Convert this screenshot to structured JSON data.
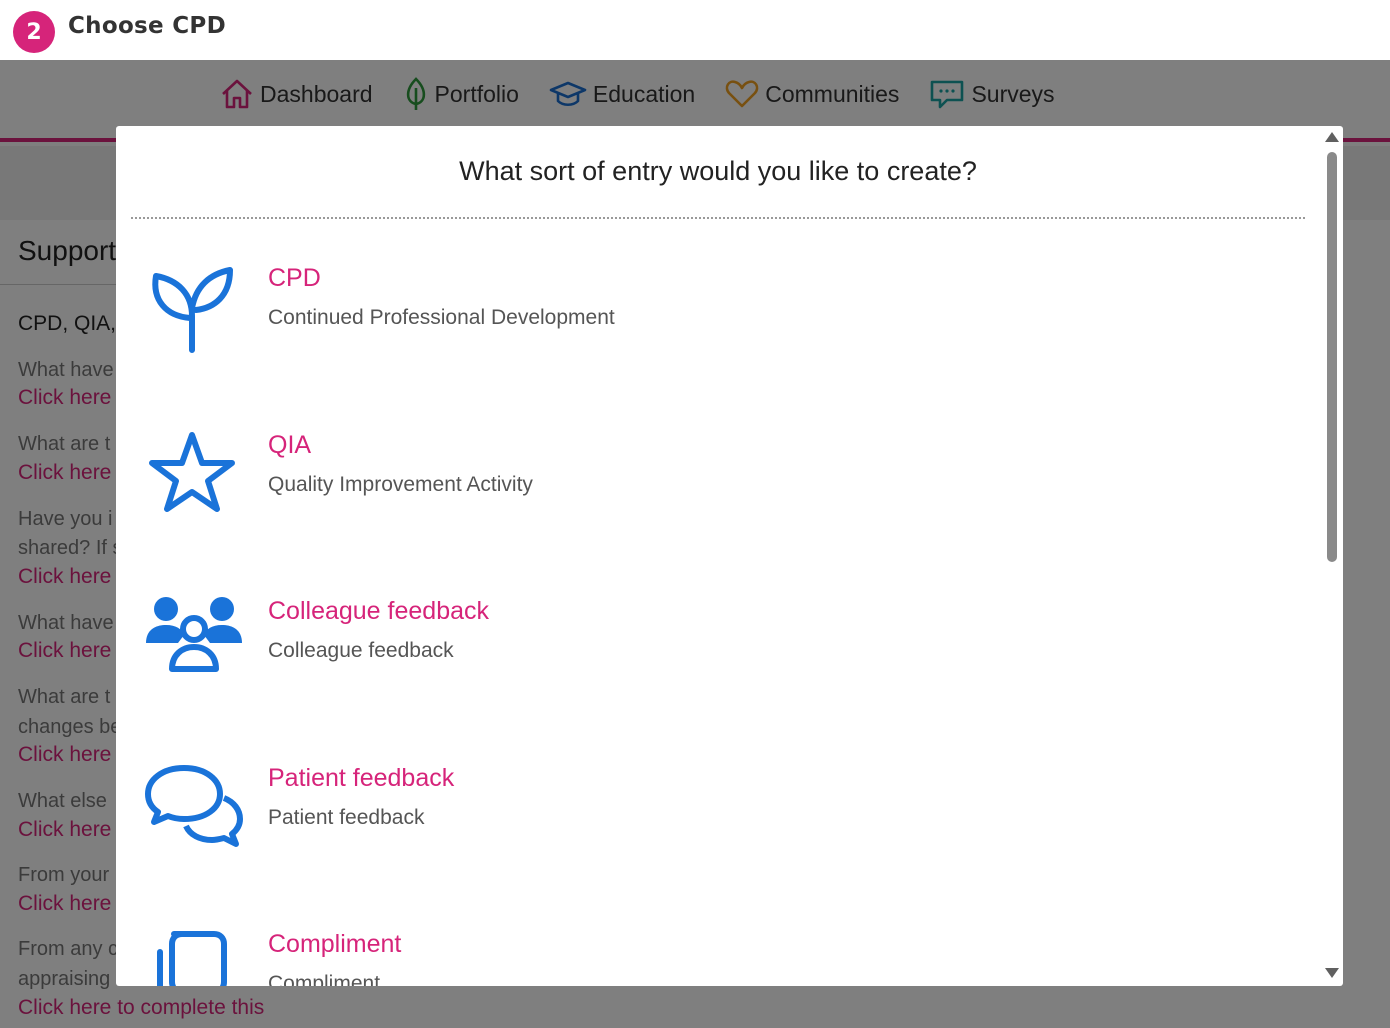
{
  "step": {
    "number": "2",
    "title": "Choose CPD"
  },
  "nav": {
    "items": [
      {
        "label": "Dashboard",
        "icon": "home-icon",
        "color": "#d6247a"
      },
      {
        "label": "Portfolio",
        "icon": "leaf-icon",
        "color": "#2e9a3c"
      },
      {
        "label": "Education",
        "icon": "graduation-cap-icon",
        "color": "#1a6fd1"
      },
      {
        "label": "Communities",
        "icon": "heart-icon",
        "color": "#f0a020"
      },
      {
        "label": "Surveys",
        "icon": "chat-icon",
        "color": "#1aa3a3"
      }
    ]
  },
  "side": {
    "title": "Support",
    "subtitle": "CPD, QIA,",
    "questions": [
      {
        "q": [
          "What have"
        ],
        "link": "Click here"
      },
      {
        "q": [
          "What are t"
        ],
        "link": "Click here"
      },
      {
        "q": [
          "Have you i",
          "shared? If s"
        ],
        "link": "Click here"
      },
      {
        "q": [
          "What have"
        ],
        "link": "Click here"
      },
      {
        "q": [
          "What are t",
          "changes be"
        ],
        "link": "Click here"
      },
      {
        "q": [
          "What else"
        ],
        "link": "Click here"
      },
      {
        "q": [
          "From your"
        ],
        "link": "Click here"
      },
      {
        "q": [
          "From any c",
          "appraising"
        ],
        "link": "Click here to complete this"
      }
    ]
  },
  "modal": {
    "title": "What sort of entry would you like to create?",
    "entries": [
      {
        "title": "CPD",
        "description": "Continued Professional Development",
        "icon": "sprout-icon"
      },
      {
        "title": "QIA",
        "description": "Quality Improvement Activity",
        "icon": "star-icon"
      },
      {
        "title": "Colleague feedback",
        "description": "Colleague feedback",
        "icon": "people-icon"
      },
      {
        "title": "Patient feedback",
        "description": "Patient feedback",
        "icon": "speech-bubbles-icon"
      },
      {
        "title": "Compliment",
        "description": "Compliment",
        "icon": "documents-icon"
      }
    ]
  },
  "colors": {
    "accent": "#d6247a",
    "icon_blue": "#1a73d9"
  }
}
